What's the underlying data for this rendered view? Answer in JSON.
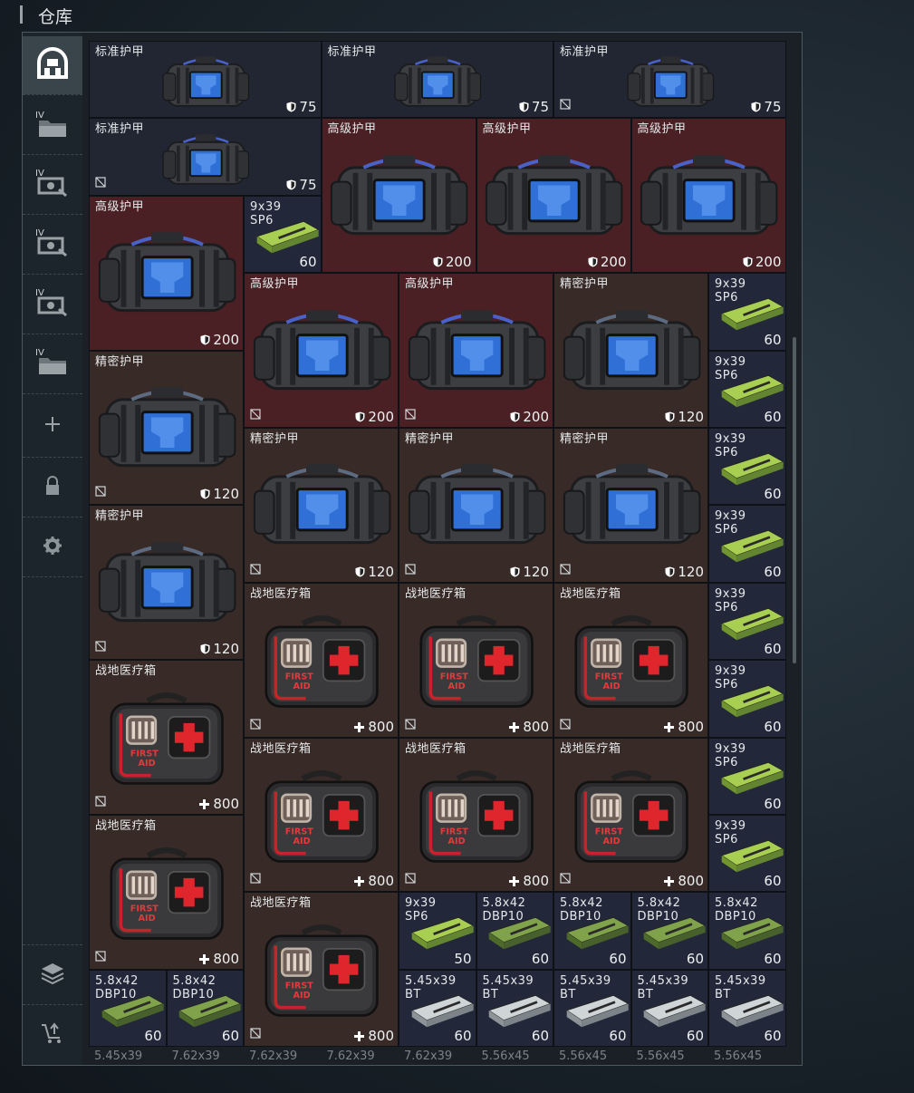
{
  "title": "仓库",
  "sidebar": [
    "home-icon",
    "folder-iv-icon",
    "scope-iv-icon",
    "scope-iv-icon",
    "scope-iv-icon",
    "folder-iv-icon",
    "plus-icon",
    "lock-icon",
    "gear-icon",
    "layers-icon",
    "cart-icon"
  ],
  "items": [
    {
      "type": "std",
      "name": "标准护甲",
      "value": "75",
      "icon": "shield-icon",
      "lock": false
    },
    {
      "type": "std",
      "name": "标准护甲",
      "value": "75",
      "icon": "shield-icon",
      "lock": false
    },
    {
      "type": "std",
      "name": "标准护甲",
      "value": "75",
      "icon": "shield-icon",
      "lock": true
    },
    {
      "type": "std",
      "name": "标准护甲",
      "value": "75",
      "icon": "shield-icon",
      "lock": true
    },
    {
      "type": "adv",
      "name": "高级护甲",
      "value": "200",
      "icon": "shield-icon",
      "lock": false
    },
    {
      "type": "adv",
      "name": "高级护甲",
      "value": "200",
      "icon": "shield-icon",
      "lock": false
    },
    {
      "type": "adv",
      "name": "高级护甲",
      "value": "200",
      "icon": "shield-icon",
      "lock": false
    },
    {
      "type": "adv",
      "name": "高级护甲",
      "value": "200",
      "icon": "shield-icon",
      "lock": false
    },
    {
      "type": "amm",
      "name": "9x39\nSP6",
      "value": "60",
      "lock": false
    },
    {
      "type": "adv",
      "name": "高级护甲",
      "value": "200",
      "icon": "shield-icon",
      "lock": true
    },
    {
      "type": "adv",
      "name": "高级护甲",
      "value": "200",
      "icon": "shield-icon",
      "lock": true
    },
    {
      "type": "pre",
      "name": "精密护甲",
      "value": "120",
      "icon": "shield-icon",
      "lock": false
    },
    {
      "type": "amm",
      "name": "9x39\nSP6",
      "value": "60",
      "lock": false
    },
    {
      "type": "pre",
      "name": "精密护甲",
      "value": "120",
      "icon": "shield-icon",
      "lock": true
    },
    {
      "type": "amm",
      "name": "9x39\nSP6",
      "value": "60",
      "lock": false
    },
    {
      "type": "pre",
      "name": "精密护甲",
      "value": "120",
      "icon": "shield-icon",
      "lock": true
    },
    {
      "type": "pre",
      "name": "精密护甲",
      "value": "120",
      "icon": "shield-icon",
      "lock": true
    },
    {
      "type": "pre",
      "name": "精密护甲",
      "value": "120",
      "icon": "shield-icon",
      "lock": true
    },
    {
      "type": "amm",
      "name": "9x39\nSP6",
      "value": "60",
      "lock": false
    },
    {
      "type": "pre",
      "name": "精密护甲",
      "value": "120",
      "icon": "shield-icon",
      "lock": true
    },
    {
      "type": "amm",
      "name": "9x39\nSP6",
      "value": "60",
      "lock": false
    },
    {
      "type": "med",
      "name": "战地医疗箱",
      "value": "800",
      "icon": "plus-icon",
      "lock": true
    },
    {
      "type": "med",
      "name": "战地医疗箱",
      "value": "800",
      "icon": "plus-icon",
      "lock": true
    },
    {
      "type": "med",
      "name": "战地医疗箱",
      "value": "800",
      "icon": "plus-icon",
      "lock": true
    },
    {
      "type": "amm",
      "name": "9x39\nSP6",
      "value": "60",
      "lock": false
    },
    {
      "type": "med",
      "name": "战地医疗箱",
      "value": "800",
      "icon": "plus-icon",
      "lock": true
    },
    {
      "type": "amm",
      "name": "9x39\nSP6",
      "value": "60",
      "lock": false
    },
    {
      "type": "med",
      "name": "战地医疗箱",
      "value": "800",
      "icon": "plus-icon",
      "lock": true
    },
    {
      "type": "med",
      "name": "战地医疗箱",
      "value": "800",
      "icon": "plus-icon",
      "lock": true
    },
    {
      "type": "med",
      "name": "战地医疗箱",
      "value": "800",
      "icon": "plus-icon",
      "lock": true
    },
    {
      "type": "amm",
      "name": "9x39\nSP6",
      "value": "60",
      "lock": false
    },
    {
      "type": "med",
      "name": "战地医疗箱",
      "value": "800",
      "icon": "plus-icon",
      "lock": true
    },
    {
      "type": "amm",
      "name": "9x39\nSP6",
      "value": "60",
      "lock": false
    },
    {
      "type": "med",
      "name": "战地医疗箱",
      "value": "800",
      "icon": "plus-icon",
      "lock": true
    },
    {
      "type": "amm",
      "name": "9x39\nSP6",
      "value": "50",
      "lock": false
    },
    {
      "type": "amm",
      "name": "5.8x42\nDBP10",
      "value": "60",
      "lock": false
    },
    {
      "type": "amm",
      "name": "5.8x42\nDBP10",
      "value": "60",
      "lock": false
    },
    {
      "type": "amm",
      "name": "5.8x42\nDBP10",
      "value": "60",
      "lock": false
    },
    {
      "type": "amm",
      "name": "5.8x42\nDBP10",
      "value": "60",
      "lock": false
    },
    {
      "type": "amm",
      "name": "5.8x42\nDBP10",
      "value": "60",
      "lock": false
    },
    {
      "type": "amm",
      "name": "5.8x42\nDBP10",
      "value": "60",
      "lock": false
    },
    {
      "type": "ammw",
      "name": "5.45x39\nBT",
      "value": "60",
      "lock": false
    },
    {
      "type": "ammw",
      "name": "5.45x39\nBT",
      "value": "60",
      "lock": false
    },
    {
      "type": "ammw",
      "name": "5.45x39\nBT",
      "value": "60",
      "lock": false
    },
    {
      "type": "ammw",
      "name": "5.45x39\nBT",
      "value": "60",
      "lock": false
    },
    {
      "type": "ammw",
      "name": "5.45x39\nBT",
      "value": "60",
      "lock": false
    }
  ],
  "partial_row": [
    "5.45x39",
    "7.62x39",
    "7.62x39",
    "7.62x39",
    "7.62x39",
    "5.56x45",
    "5.56x45",
    "5.56x45",
    "5.56x45"
  ]
}
